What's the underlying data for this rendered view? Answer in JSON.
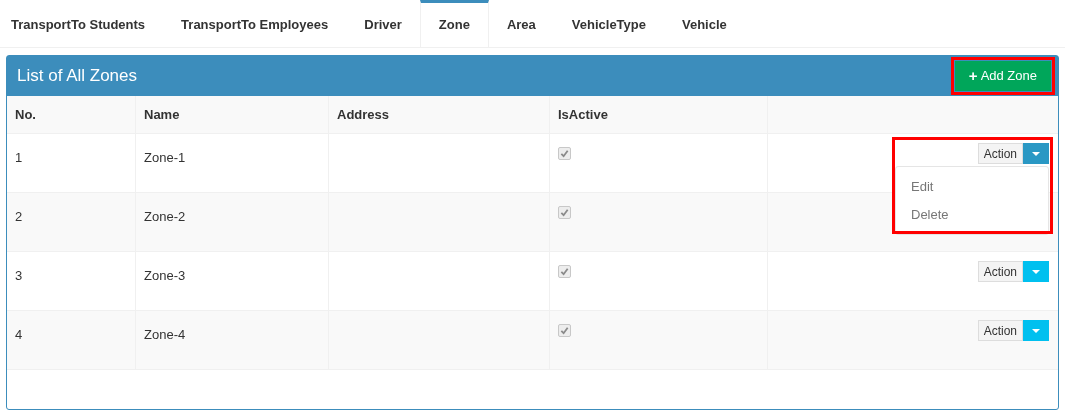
{
  "tabs": [
    {
      "label": "TransportTo Students",
      "selected": false
    },
    {
      "label": "TransportTo Employees",
      "selected": false
    },
    {
      "label": "Driver",
      "selected": false
    },
    {
      "label": "Zone",
      "selected": true
    },
    {
      "label": "Area",
      "selected": false
    },
    {
      "label": "VehicleType",
      "selected": false
    },
    {
      "label": "Vehicle",
      "selected": false
    }
  ],
  "panel": {
    "title": "List of All Zones",
    "add_button": {
      "icon": "+",
      "label": "Add Zone",
      "highlighted": true
    }
  },
  "table": {
    "columns": [
      "No.",
      "Name",
      "Address",
      "IsActive"
    ],
    "rows": [
      {
        "no": "1",
        "name": "Zone-1",
        "is_active": true,
        "action": {
          "label": "Action",
          "expanded": true,
          "menu": [
            "Edit",
            "Delete"
          ],
          "highlighted": true
        }
      },
      {
        "no": "2",
        "name": "Zone-2",
        "is_active": true
      },
      {
        "no": "3",
        "name": "Zone-3",
        "is_active": true,
        "action": {
          "label": "Action",
          "expanded": false,
          "highlighted": false
        }
      },
      {
        "no": "4",
        "name": "Zone-4",
        "is_active": true,
        "action": {
          "label": "Action",
          "expanded": false,
          "highlighted": false
        }
      }
    ]
  }
}
